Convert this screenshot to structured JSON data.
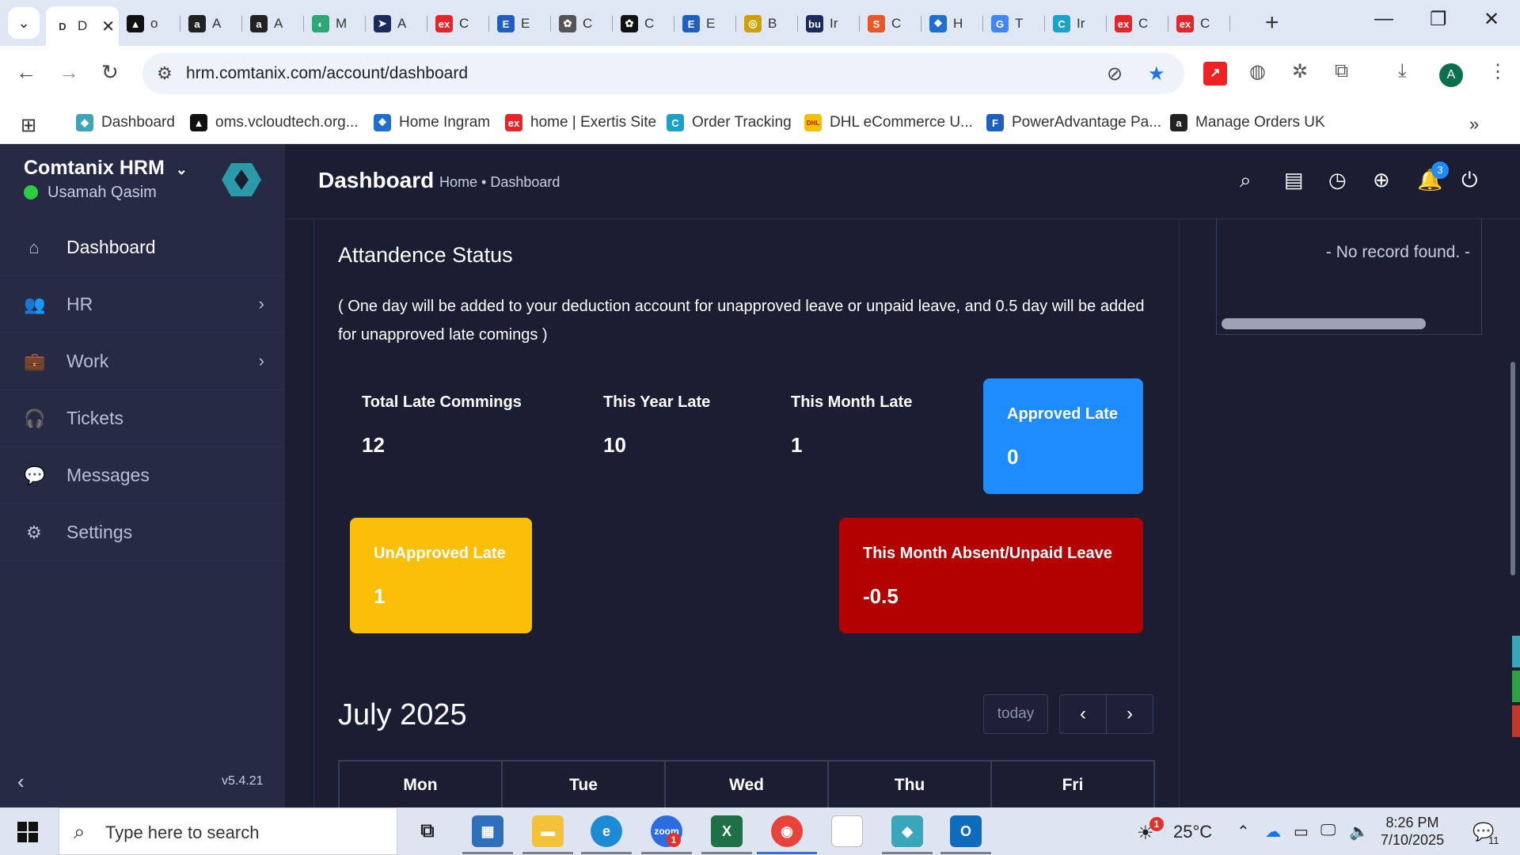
{
  "browser": {
    "tabs": [
      {
        "label": "D",
        "icon_color": "#ffffff",
        "icon": "D",
        "active": true
      },
      {
        "label": "o",
        "icon_color": "#111111",
        "icon": "▲"
      },
      {
        "label": "A",
        "icon_color": "#222222",
        "icon": "a"
      },
      {
        "label": "A",
        "icon_color": "#222222",
        "icon": "a"
      },
      {
        "label": "M",
        "icon_color": "#2aa876",
        "icon": "◐"
      },
      {
        "label": "A",
        "icon_color": "#1a2b5c",
        "icon": "➤"
      },
      {
        "label": "C",
        "icon_color": "#e4262a",
        "icon": "ex"
      },
      {
        "label": "E",
        "icon_color": "#1f5fbf",
        "icon": "E"
      },
      {
        "label": "C",
        "icon_color": "#555555",
        "icon": "✿"
      },
      {
        "label": "C",
        "icon_color": "#111111",
        "icon": "✿"
      },
      {
        "label": "E",
        "icon_color": "#1f5fbf",
        "icon": "E"
      },
      {
        "label": "B",
        "icon_color": "#d0a000",
        "icon": "◎"
      },
      {
        "label": "Ir",
        "icon_color": "#1a2b5c",
        "icon": "bu"
      },
      {
        "label": "C",
        "icon_color": "#e8562a",
        "icon": "S"
      },
      {
        "label": "H",
        "icon_color": "#1f6fcf",
        "icon": "❖"
      },
      {
        "label": "T",
        "icon_color": "#4285f4",
        "icon": "G"
      },
      {
        "label": "Ir",
        "icon_color": "#1aa3c7",
        "icon": "C"
      },
      {
        "label": "C",
        "icon_color": "#e4262a",
        "icon": "ex"
      },
      {
        "label": "C",
        "icon_color": "#e4262a",
        "icon": "ex"
      }
    ],
    "url": "hrm.comtanix.com/account/dashboard",
    "profile_initial": "A",
    "bookmarks": [
      {
        "label": "Dashboard",
        "icon_color": "#3aa6b9",
        "icon": "◆"
      },
      {
        "label": "oms.vcloudtech.org...",
        "icon_color": "#111111",
        "icon": "▲"
      },
      {
        "label": "Home Ingram",
        "icon_color": "#1f6fcf",
        "icon": "❖"
      },
      {
        "label": "home | Exertis Site",
        "icon_color": "#e4262a",
        "icon": "ex"
      },
      {
        "label": "Order Tracking",
        "icon_color": "#1aa3c7",
        "icon": "C"
      },
      {
        "label": "DHL eCommerce U...",
        "icon_color": "#f2c200",
        "icon": "DHL"
      },
      {
        "label": "PowerAdvantage Pa...",
        "icon_color": "#1f5fbf",
        "icon": "F"
      },
      {
        "label": "Manage Orders UK",
        "icon_color": "#222222",
        "icon": "a"
      }
    ]
  },
  "app": {
    "brand": "Comtanix HRM",
    "user": "Usamah Qasim",
    "menu": [
      {
        "label": "Dashboard",
        "icon": "⌂",
        "active": true,
        "chevron": false
      },
      {
        "label": "HR",
        "icon": "👥",
        "chevron": true
      },
      {
        "label": "Work",
        "icon": "💼",
        "chevron": true
      },
      {
        "label": "Tickets",
        "icon": "🎧",
        "chevron": false
      },
      {
        "label": "Messages",
        "icon": "💬",
        "chevron": false
      },
      {
        "label": "Settings",
        "icon": "⚙",
        "chevron": false
      }
    ],
    "version": "v5.4.21",
    "header": {
      "title": "Dashboard",
      "breadcrumb": "Home • Dashboard",
      "notification_count": "3"
    }
  },
  "attendance": {
    "title": "Attandence Status",
    "note": "( One day will be added to your deduction account for unapproved leave or unpaid leave, and 0.5 day will be added for unapproved late comings )",
    "stats": [
      {
        "label": "Total Late Commings",
        "value": "12"
      },
      {
        "label": "This Year Late",
        "value": "10"
      },
      {
        "label": "This Month Late",
        "value": "1"
      }
    ],
    "tiles": {
      "approved": {
        "label": "Approved Late",
        "value": "0",
        "color": "#1e8bff"
      },
      "unapproved": {
        "label": "UnApproved Late",
        "value": "1",
        "color": "#fbbf0a"
      },
      "absent": {
        "label": "This Month Absent/Unpaid Leave",
        "value": "-0.5",
        "color": "#b30000"
      }
    }
  },
  "calendar": {
    "month": "July 2025",
    "today_label": "today",
    "days": [
      "Mon",
      "Tue",
      "Wed",
      "Thu",
      "Fri"
    ]
  },
  "side_panel": {
    "empty_text": "- No record found. -"
  },
  "taskbar": {
    "search_placeholder": "Type here to search",
    "weather": "25°C",
    "time": "8:26 PM",
    "date": "7/10/2025",
    "notification_count": "11",
    "zoom_badge": "1",
    "weather_badge": "1"
  }
}
